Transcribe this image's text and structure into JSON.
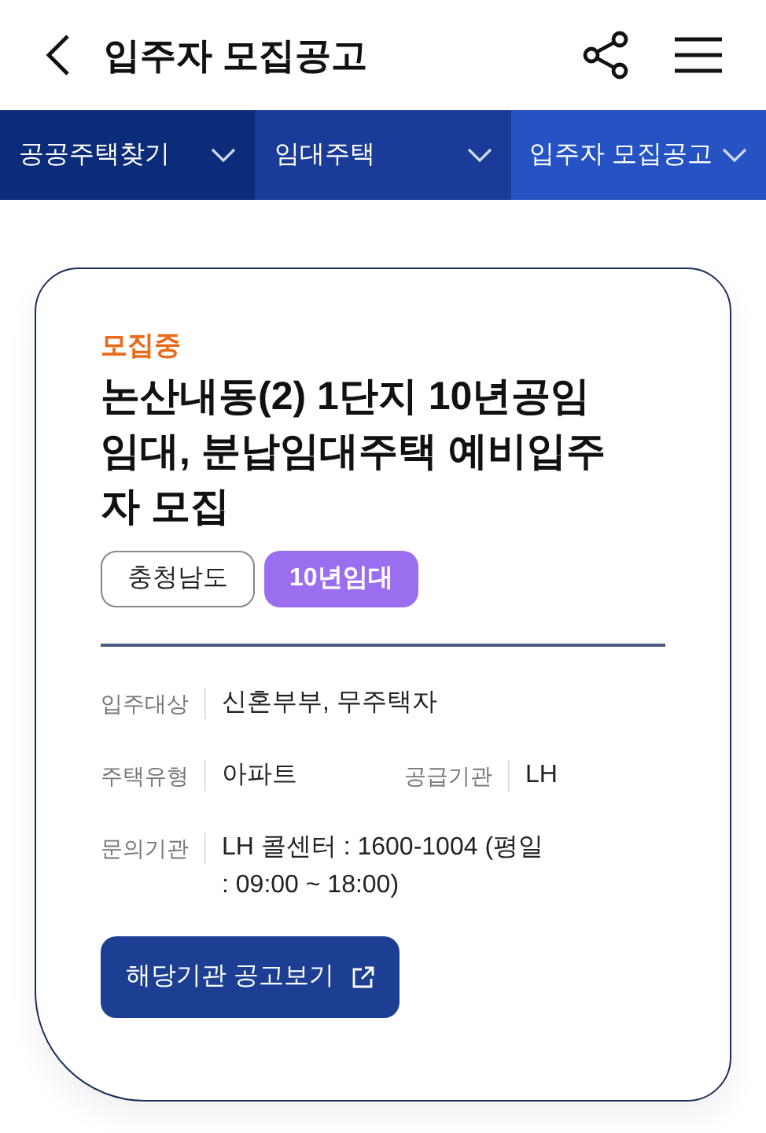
{
  "header": {
    "title": "입주자 모집공고"
  },
  "breadcrumbs": [
    {
      "label": "공공주택찾기",
      "color": "#0b2c78"
    },
    {
      "label": "임대주택",
      "color": "#1a3c98"
    },
    {
      "label": "입주자 모집공고",
      "color": "#2553c4"
    }
  ],
  "notice": {
    "status": "모집중",
    "title": "논산내동(2) 1단지 10년공임임대, 분납임대주택 예비입주자 모집",
    "tags": [
      {
        "label": "충청남도",
        "kind": "outline"
      },
      {
        "label": "10년임대",
        "kind": "filled"
      }
    ],
    "info_rows": [
      {
        "fields": [
          {
            "label": "입주대상",
            "value": "신혼부부, 무주택자"
          }
        ]
      },
      {
        "fields": [
          {
            "label": "주택유형",
            "value": "아파트"
          },
          {
            "label": "공급기관",
            "value": "LH"
          }
        ]
      },
      {
        "fields": [
          {
            "label": "문의기관",
            "value": "LH 콜센터 : 1600-1004 (평일 : 09:00 ~ 18:00)"
          }
        ]
      }
    ],
    "button": "해당기관 공고보기"
  }
}
